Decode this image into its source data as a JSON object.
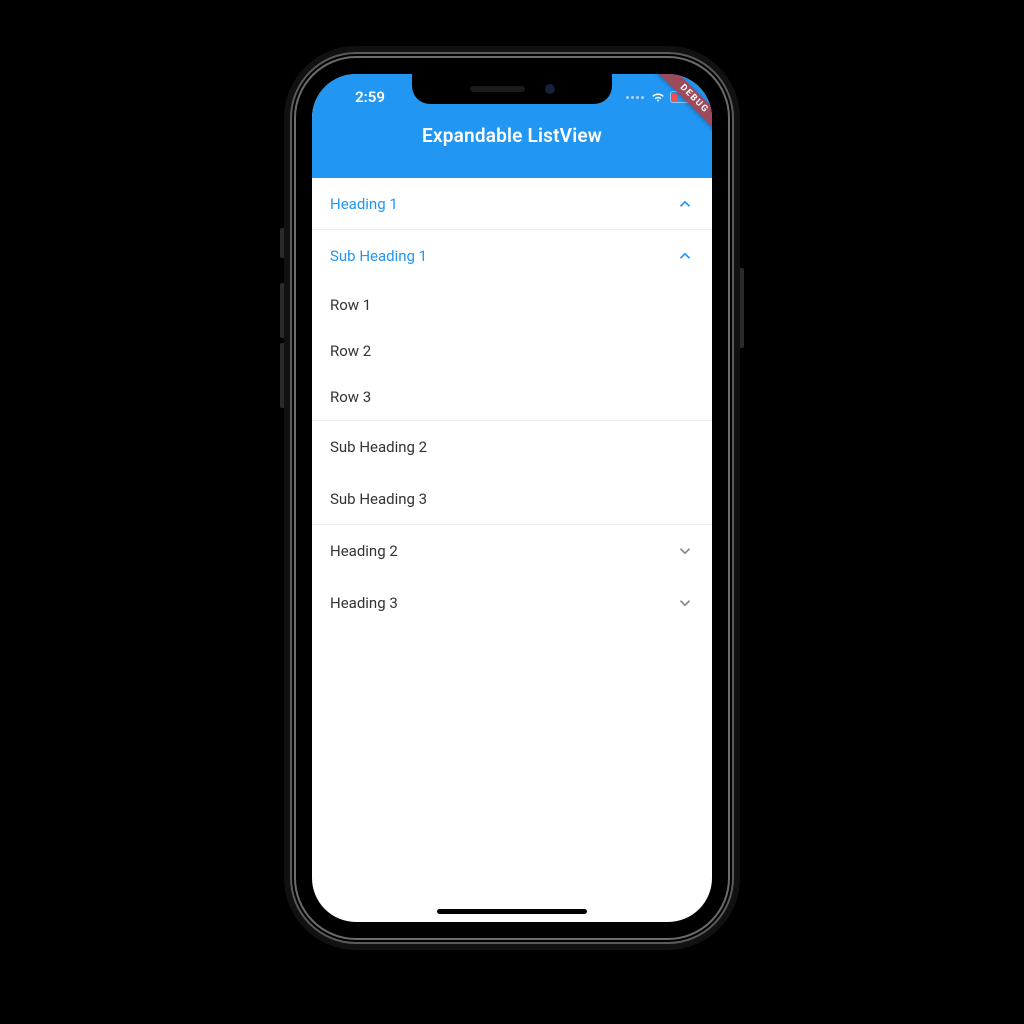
{
  "status": {
    "time": "2:59"
  },
  "debug_banner": "DEBUG",
  "appbar": {
    "title": "Expandable ListView"
  },
  "colors": {
    "accent": "#2196f3"
  },
  "list": {
    "heading1": {
      "label": "Heading 1",
      "expanded": true,
      "sub1": {
        "label": "Sub Heading 1",
        "expanded": true,
        "rows": [
          "Row 1",
          "Row 2",
          "Row 3"
        ]
      },
      "sub2": {
        "label": "Sub Heading 2"
      },
      "sub3": {
        "label": "Sub Heading 3"
      }
    },
    "heading2": {
      "label": "Heading 2",
      "expanded": false
    },
    "heading3": {
      "label": "Heading 3",
      "expanded": false
    }
  }
}
